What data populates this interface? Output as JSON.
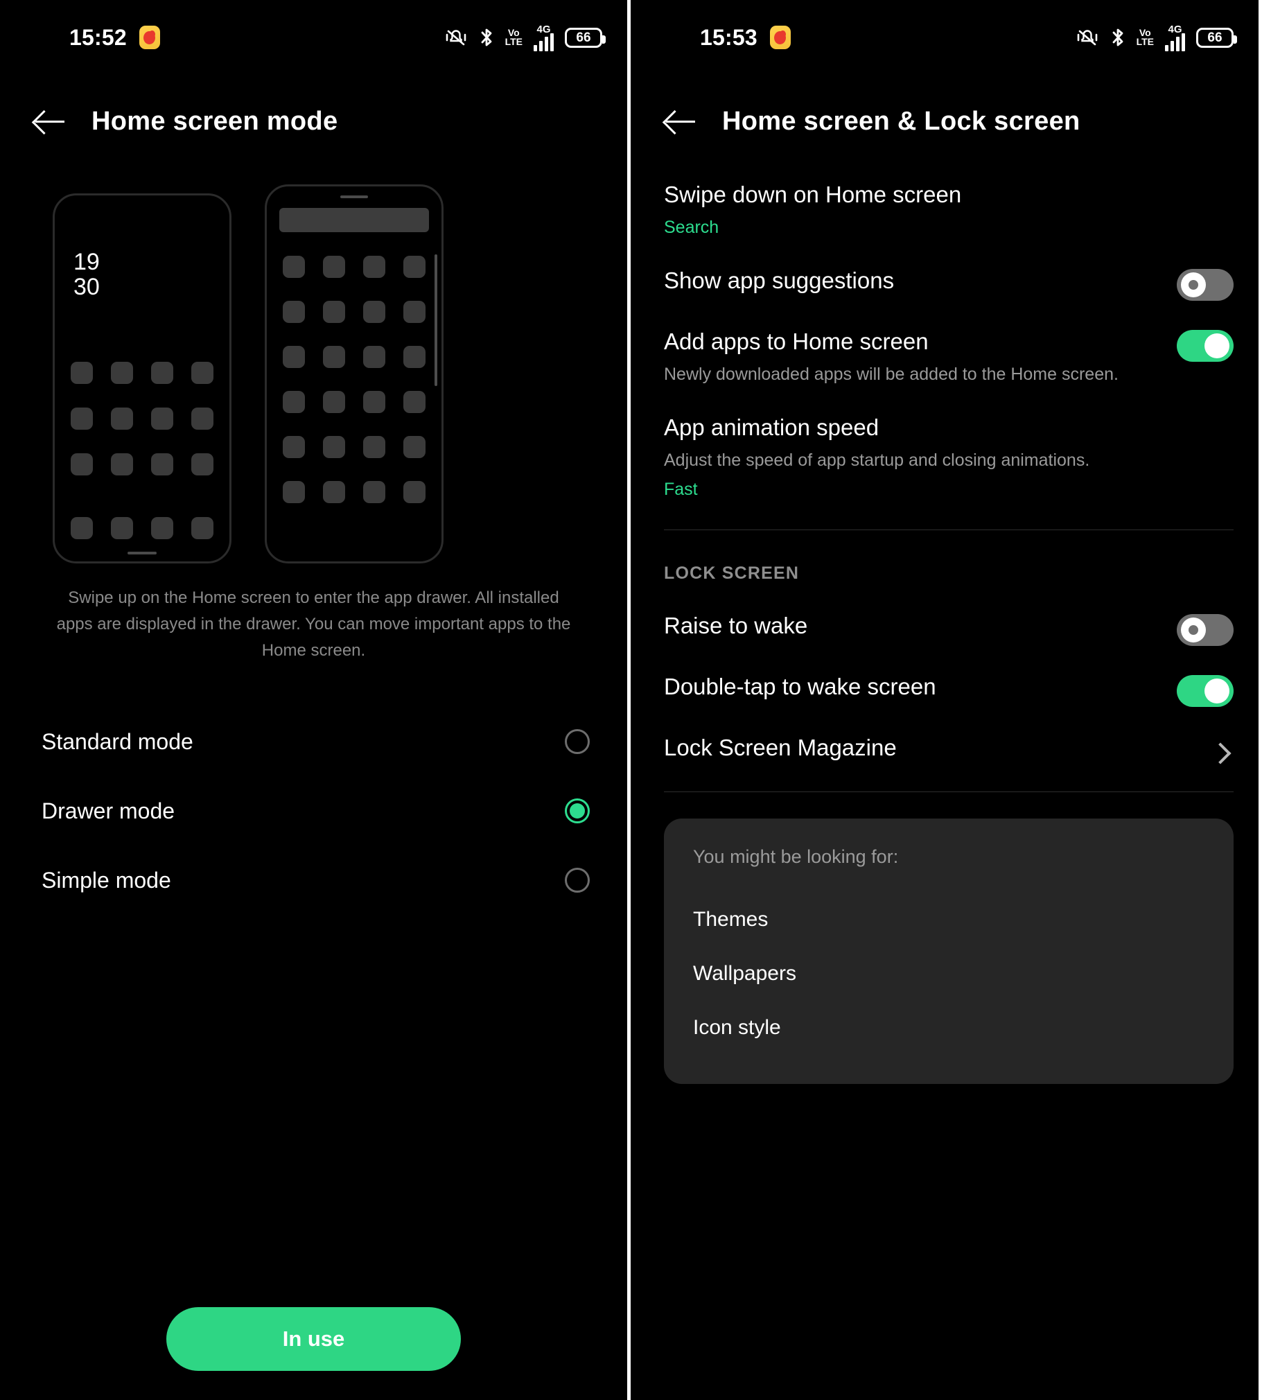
{
  "left": {
    "status_bar": {
      "time": "15:52",
      "app_icon": "weibo-icon",
      "icons": [
        "vibrate-off-icon",
        "bluetooth-icon",
        "volte-icon",
        "4g-signal-icon",
        "battery-icon"
      ],
      "volte_top": "Vo",
      "volte_bottom": "LTE",
      "network": "4G",
      "battery_percent": "66"
    },
    "title": "Home screen mode",
    "back_icon": "back-arrow-icon",
    "mockups": {
      "standard": {
        "clock_hours": "19",
        "clock_minutes": "30"
      },
      "drawer": {}
    },
    "description": "Swipe up on the Home screen to enter the app drawer. All installed apps are displayed in the drawer. You can move important apps to the Home screen.",
    "options": [
      {
        "label": "Standard mode",
        "selected": false
      },
      {
        "label": "Drawer mode",
        "selected": true
      },
      {
        "label": "Simple mode",
        "selected": false
      }
    ],
    "primary_button": "In use"
  },
  "right": {
    "status_bar": {
      "time": "15:53",
      "app_icon": "weibo-icon",
      "volte_top": "Vo",
      "volte_bottom": "LTE",
      "network": "4G",
      "battery_percent": "66"
    },
    "title": "Home screen & Lock screen",
    "back_icon": "back-arrow-icon",
    "rows": [
      {
        "title": "Swipe down on Home screen",
        "value": "Search",
        "control": "none"
      },
      {
        "title": "Show app suggestions",
        "control": "toggle",
        "state": "off"
      },
      {
        "title": "Add apps to Home screen",
        "sub": "Newly downloaded apps will be added to the Home screen.",
        "control": "toggle",
        "state": "on"
      },
      {
        "title": "App animation speed",
        "sub": "Adjust the speed of app startup and closing animations.",
        "value": "Fast",
        "control": "none"
      }
    ],
    "lock_section_header": "LOCK SCREEN",
    "lock_rows": [
      {
        "title": "Raise to wake",
        "control": "toggle",
        "state": "off"
      },
      {
        "title": "Double-tap to wake screen",
        "control": "toggle",
        "state": "on"
      },
      {
        "title": "Lock Screen Magazine",
        "control": "chevron"
      }
    ],
    "card": {
      "header": "You might be looking for:",
      "items": [
        "Themes",
        "Wallpapers",
        "Icon style"
      ]
    }
  },
  "colors": {
    "accent_green": "#2ed684",
    "value_green": "#2ddd8f",
    "background": "#000000",
    "card_background": "#262626",
    "secondary_text": "#9a9a9a"
  }
}
